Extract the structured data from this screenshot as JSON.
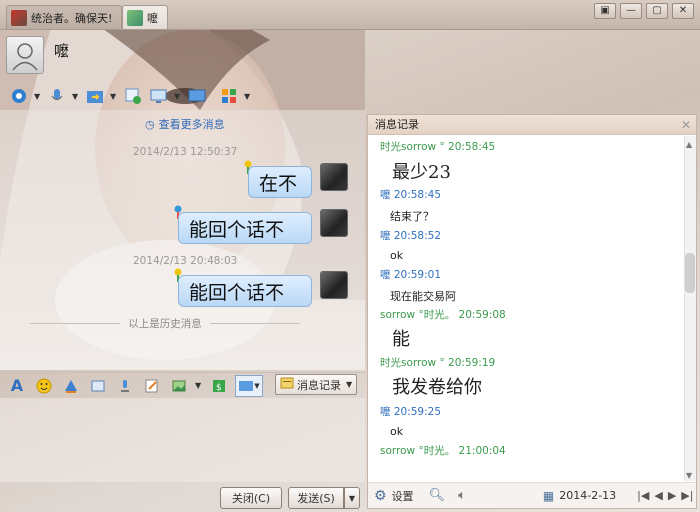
{
  "titlebar": {
    "tabs": [
      {
        "label": "统治者。确保天!",
        "icon": "group-avatar-icon"
      },
      {
        "label": "嚒",
        "icon": "contact-avatar-icon"
      }
    ],
    "window_controls": [
      "restore-icon",
      "minimize-icon",
      "maximize-icon",
      "close-icon"
    ]
  },
  "contact": {
    "name": "嚒"
  },
  "chat": {
    "view_more": "查看更多消息",
    "messages": [
      {
        "time": "2014/2/13 12:50:37",
        "text": "在不"
      },
      {
        "text": "能回个话不"
      },
      {
        "time": "2014/2/13 20:48:03",
        "text": "能回个话不"
      }
    ],
    "history_separator": "以上是历史消息"
  },
  "input_toolbar": {
    "message_record": "消息记录"
  },
  "buttons": {
    "close": "关闭(C)",
    "send": "发送(S)"
  },
  "history": {
    "title": "消息记录",
    "entries": [
      {
        "sender": "时光sorrow ° 20:58:45",
        "who": "other",
        "text": "最少23",
        "big": true
      },
      {
        "sender": "嚒 20:58:45",
        "who": "me",
        "text": "结束了？",
        "big": false
      },
      {
        "sender": "嚒 20:58:52",
        "who": "me",
        "text": "ok",
        "big": false
      },
      {
        "sender": "嚒 20:59:01",
        "who": "me",
        "text": "现在能交易阿",
        "big": false
      },
      {
        "sender": "sorrow °时光。 20:59:08",
        "who": "other",
        "text": "能",
        "big": true
      },
      {
        "sender": "时光sorrow ° 20:59:19",
        "who": "other",
        "text": "我发卷给你",
        "big": true
      },
      {
        "sender": "嚒 20:59:25",
        "who": "me",
        "text": "ok",
        "big": false
      },
      {
        "sender": "sorrow °时光。 21:00:04",
        "who": "other",
        "text": "",
        "big": false
      }
    ],
    "footer": {
      "settings": "设置",
      "date": "2014-2-13"
    }
  },
  "colors": {
    "bubble": "#c9e2fa",
    "sender_other": "#3b9a4e",
    "sender_me": "#2f6fc0",
    "accent": "#2e69b8"
  }
}
